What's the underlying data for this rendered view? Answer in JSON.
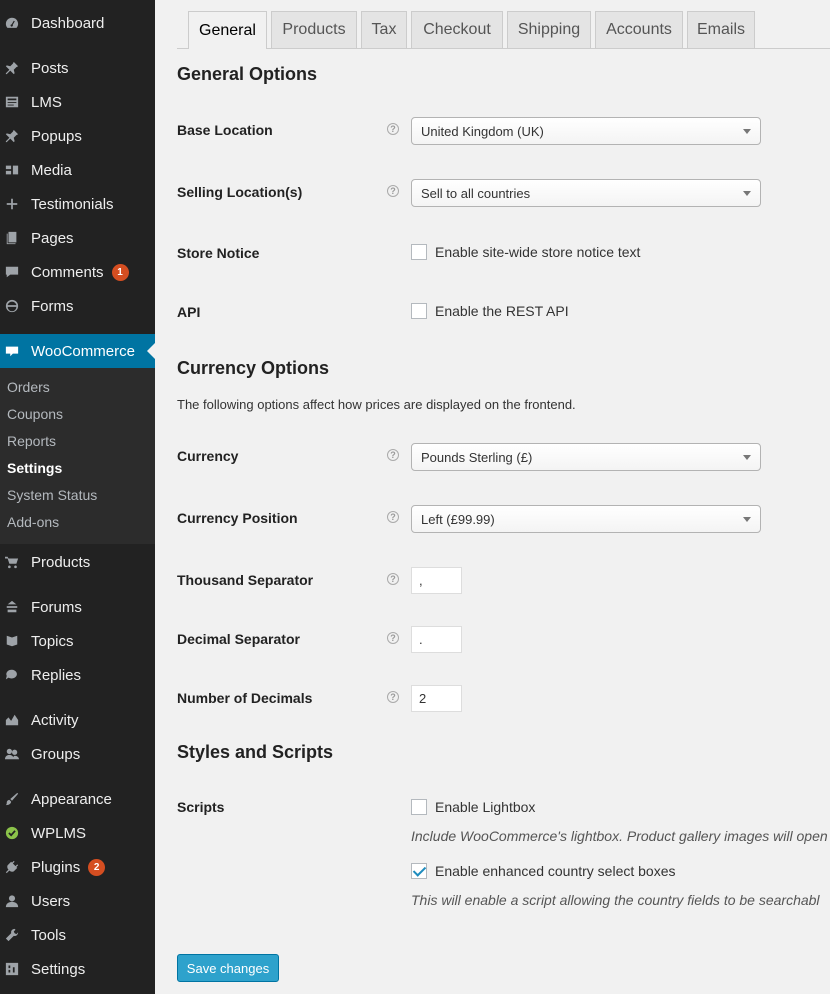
{
  "sidebar": {
    "menu": [
      {
        "label": "Dashboard",
        "icon": "dashboard-icon"
      },
      {
        "label": "Posts",
        "icon": "pin-icon"
      },
      {
        "label": "LMS",
        "icon": "lms-icon"
      },
      {
        "label": "Popups",
        "icon": "pin-icon"
      },
      {
        "label": "Media",
        "icon": "media-icon"
      },
      {
        "label": "Testimonials",
        "icon": "plus-icon"
      },
      {
        "label": "Pages",
        "icon": "pages-icon"
      },
      {
        "label": "Comments",
        "icon": "comment-icon",
        "badge": "1"
      },
      {
        "label": "Forms",
        "icon": "forms-icon"
      },
      {
        "label": "WooCommerce",
        "icon": "woo-icon"
      },
      {
        "label": "Products",
        "icon": "cart-icon"
      },
      {
        "label": "Forums",
        "icon": "forums-icon"
      },
      {
        "label": "Topics",
        "icon": "topics-icon"
      },
      {
        "label": "Replies",
        "icon": "replies-icon"
      },
      {
        "label": "Activity",
        "icon": "activity-icon"
      },
      {
        "label": "Groups",
        "icon": "groups-icon"
      },
      {
        "label": "Appearance",
        "icon": "brush-icon"
      },
      {
        "label": "WPLMS",
        "icon": "check-circle-icon"
      },
      {
        "label": "Plugins",
        "icon": "plug-icon",
        "badge": "2"
      },
      {
        "label": "Users",
        "icon": "user-icon"
      },
      {
        "label": "Tools",
        "icon": "wrench-icon"
      },
      {
        "label": "Settings",
        "icon": "settings-icon"
      }
    ],
    "submenu": [
      "Orders",
      "Coupons",
      "Reports",
      "Settings",
      "System Status",
      "Add-ons"
    ]
  },
  "tabs": [
    "General",
    "Products",
    "Tax",
    "Checkout",
    "Shipping",
    "Accounts",
    "Emails"
  ],
  "general_options": {
    "heading": "General Options",
    "base_location": {
      "label": "Base Location",
      "value": "United Kingdom (UK)"
    },
    "selling_locations": {
      "label": "Selling Location(s)",
      "value": "Sell to all countries"
    },
    "store_notice": {
      "label": "Store Notice",
      "checkbox_label": "Enable site-wide store notice text",
      "checked": false
    },
    "api": {
      "label": "API",
      "checkbox_label": "Enable the REST API",
      "checked": false
    }
  },
  "currency_options": {
    "heading": "Currency Options",
    "intro": "The following options affect how prices are displayed on the frontend.",
    "currency": {
      "label": "Currency",
      "value": "Pounds Sterling (£)"
    },
    "currency_position": {
      "label": "Currency Position",
      "value": "Left (£99.99)"
    },
    "thousand_separator": {
      "label": "Thousand Separator",
      "value": ","
    },
    "decimal_separator": {
      "label": "Decimal Separator",
      "value": "."
    },
    "number_of_decimals": {
      "label": "Number of Decimals",
      "value": "2"
    }
  },
  "styles_scripts": {
    "heading": "Styles and Scripts",
    "label": "Scripts",
    "lightbox": {
      "label": "Enable Lightbox",
      "checked": false,
      "desc": "Include WooCommerce's lightbox. Product gallery images will open"
    },
    "enhanced_select": {
      "label": "Enable enhanced country select boxes",
      "checked": true,
      "desc": "This will enable a script allowing the country fields to be searchabl"
    }
  },
  "save_label": "Save changes",
  "help_glyph": "?",
  "colors": {
    "sidebar_bg": "#222222",
    "active_bg": "#0074a2",
    "badge": "#d54e21",
    "primary_button": "#2ea2cc"
  }
}
